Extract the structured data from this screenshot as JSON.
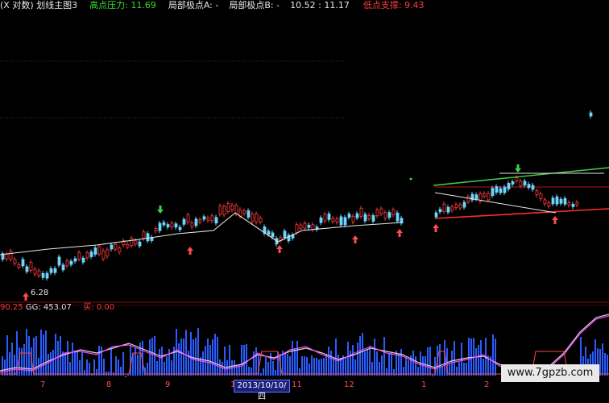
{
  "title_bar": {
    "prefix": "(X 对数) 划线主图3",
    "high_label": "高点压力:",
    "high_value": "11.69",
    "extA_label": "局部极点A:",
    "extA_value": "-",
    "extB_label": "局部极点B:",
    "extB_value": "-",
    "extB_num1": "10.52",
    "extB_sep": ":",
    "extB_num2": "11.17",
    "low_label": "低点支撑:",
    "low_value": "9.43"
  },
  "price_label": "6.28",
  "indicator_bar": {
    "left_value": "90.25",
    "gg_label": "GG:",
    "gg_value": "453.07",
    "buy_label": "买:",
    "buy_value": "0.00"
  },
  "x_ticks": [
    "7",
    "8",
    "9",
    "1",
    "11",
    "12",
    "1",
    "2"
  ],
  "date_box": "2013/10/10/四",
  "watermark": "www.7gpzb.com",
  "colors": {
    "bg": "#000000",
    "up": "#ff3b3b",
    "down": "#6fd5ff",
    "trend": "#e6e6e6",
    "resistance": "#46d046",
    "support": "#ff2d2d",
    "bar_blue": "#2b5cff",
    "line_white": "#d8d8d8",
    "line_magenta": "#ff44ff",
    "marker_red": "#ff4b4b",
    "marker_green": "#46d046"
  }
}
